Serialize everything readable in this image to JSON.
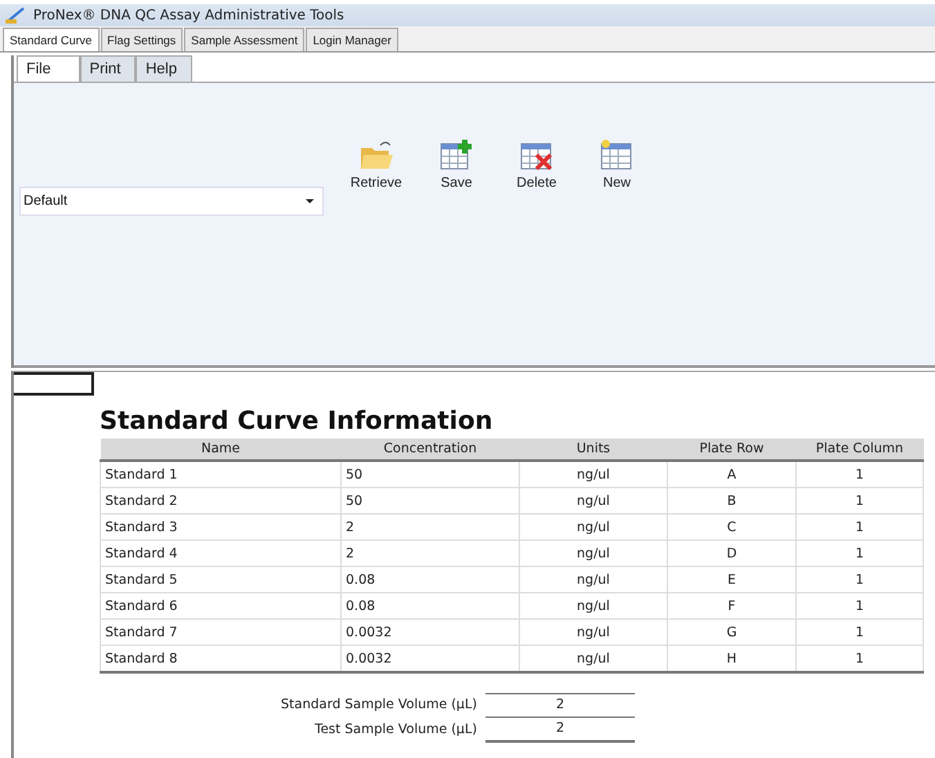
{
  "window": {
    "title": "ProNex® DNA QC Assay Administrative Tools"
  },
  "tabs": [
    {
      "label": "Standard Curve",
      "selected": true
    },
    {
      "label": "Flag Settings",
      "selected": false
    },
    {
      "label": "Sample Assessment",
      "selected": false
    },
    {
      "label": "Login Manager",
      "selected": false
    }
  ],
  "ribbon_tabs": [
    {
      "label": "File",
      "selected": true
    },
    {
      "label": "Print",
      "selected": false
    },
    {
      "label": "Help",
      "selected": false
    }
  ],
  "profile_dropdown": {
    "value": "Default"
  },
  "ribbon_buttons": [
    {
      "kind": "retrieve",
      "label": "Retrieve"
    },
    {
      "kind": "save",
      "label": "Save"
    },
    {
      "kind": "delete",
      "label": "Delete"
    },
    {
      "kind": "new",
      "label": "New"
    }
  ],
  "report": {
    "title": "Standard Curve Information",
    "table": {
      "columns": [
        "Name",
        "Concentration",
        "Units",
        "Plate Row",
        "Plate Column"
      ],
      "rows": [
        [
          "Standard 1",
          "50",
          "ng/ul",
          "A",
          "1"
        ],
        [
          "Standard 2",
          "50",
          "ng/ul",
          "B",
          "1"
        ],
        [
          "Standard 3",
          "2",
          "ng/ul",
          "C",
          "1"
        ],
        [
          "Standard 4",
          "2",
          "ng/ul",
          "D",
          "1"
        ],
        [
          "Standard 5",
          "0.08",
          "ng/ul",
          "E",
          "1"
        ],
        [
          "Standard 6",
          "0.08",
          "ng/ul",
          "F",
          "1"
        ],
        [
          "Standard 7",
          "0.0032",
          "ng/ul",
          "G",
          "1"
        ],
        [
          "Standard 8",
          "0.0032",
          "ng/ul",
          "H",
          "1"
        ]
      ]
    },
    "volumes": [
      {
        "label": "Standard Sample Volume (µL)",
        "value": "2"
      },
      {
        "label": "Test Sample Volume (µL)",
        "value": "2"
      }
    ]
  }
}
